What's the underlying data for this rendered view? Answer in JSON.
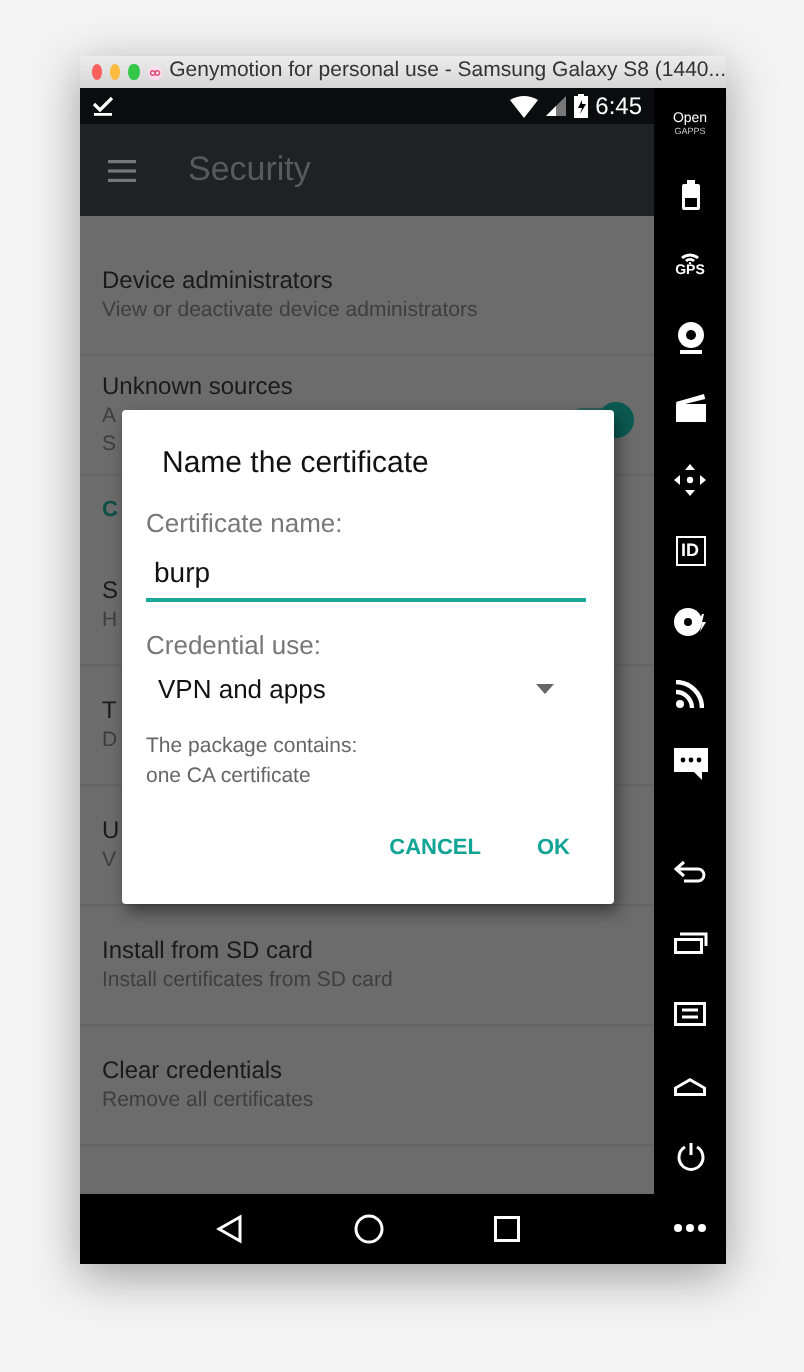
{
  "window": {
    "title": "Genymotion for personal use - Samsung Galaxy S8 (1440..."
  },
  "status_bar": {
    "time": "6:45"
  },
  "app_bar": {
    "title": "Security"
  },
  "settings": [
    {
      "kind": "item",
      "title": "Device administrators",
      "subtitle": "View or deactivate device administrators"
    },
    {
      "kind": "switch",
      "title": "Unknown sources",
      "subtitle_lines": [
        "A",
        "S"
      ],
      "on": true
    },
    {
      "kind": "category",
      "title": "C"
    },
    {
      "kind": "item",
      "title": "S",
      "subtitle": "H"
    },
    {
      "kind": "item",
      "title": "T",
      "subtitle": "D"
    },
    {
      "kind": "item",
      "title": "U",
      "subtitle": "V"
    },
    {
      "kind": "item",
      "title": "Install from SD card",
      "subtitle": "Install certificates from SD card"
    },
    {
      "kind": "item",
      "title": "Clear credentials",
      "subtitle": "Remove all certificates"
    }
  ],
  "dialog": {
    "title": "Name the certificate",
    "name_label": "Certificate name:",
    "name_value": "burp",
    "use_label": "Credential use:",
    "use_value": "VPN and apps",
    "info_lines": [
      "The package contains:",
      "one CA certificate"
    ],
    "buttons": [
      "CANCEL",
      "OK"
    ]
  },
  "sidebar": {
    "logo_lines": [
      "Open",
      "GAPPS"
    ],
    "gps_label": "GPS",
    "id_label": "ID"
  }
}
